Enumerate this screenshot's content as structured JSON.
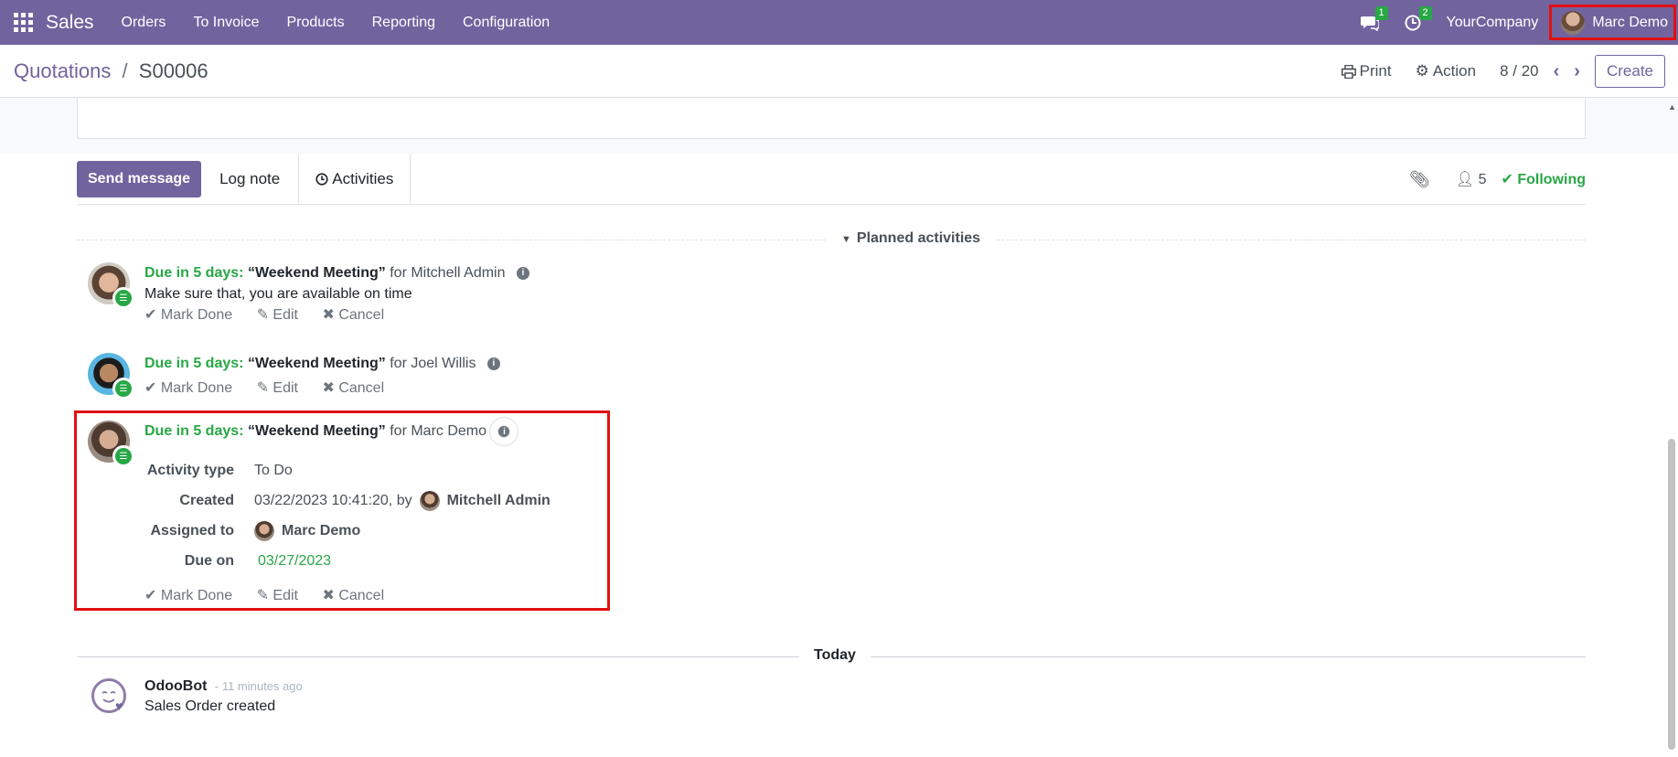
{
  "navbar": {
    "brand": "Sales",
    "menu": [
      "Orders",
      "To Invoice",
      "Products",
      "Reporting",
      "Configuration"
    ],
    "messages_badge": "1",
    "activities_badge": "2",
    "company": "YourCompany",
    "user": "Marc Demo"
  },
  "control": {
    "breadcrumb_parent": "Quotations",
    "breadcrumb_sep": "/",
    "breadcrumb_current": "S00006",
    "print_label": "Print",
    "action_label": "Action",
    "pager": "8 / 20",
    "create_label": "Create"
  },
  "chatter": {
    "send_message": "Send message",
    "log_note": "Log note",
    "activities": "Activities",
    "followers_count": "5",
    "following": "Following",
    "planned_label": "Planned activities",
    "activities_list": [
      {
        "due": "Due in 5 days:",
        "summary": "“Weekend Meeting”",
        "for": "for Mitchell Admin",
        "note": "Make sure that,  you are available on time",
        "actions": [
          "Mark Done",
          "Edit",
          "Cancel"
        ]
      },
      {
        "due": "Due in 5 days:",
        "summary": "“Weekend Meeting”",
        "for": "for Joel Willis",
        "actions": [
          "Mark Done",
          "Edit",
          "Cancel"
        ]
      },
      {
        "due": "Due in 5 days:",
        "summary": "“Weekend Meeting”",
        "for": "for Marc Demo",
        "details": {
          "type_label": "Activity type",
          "type_value": "To Do",
          "created_label": "Created",
          "created_value": "03/22/2023 10:41:20, by",
          "created_by": "Mitchell Admin",
          "assigned_label": "Assigned to",
          "assigned_value": "Marc Demo",
          "due_label": "Due on",
          "due_value": "03/27/2023"
        },
        "actions": [
          "Mark Done",
          "Edit",
          "Cancel"
        ]
      }
    ],
    "today_label": "Today",
    "message": {
      "author": "OdooBot",
      "time": "- 11 minutes ago",
      "text": "Sales Order created"
    }
  }
}
